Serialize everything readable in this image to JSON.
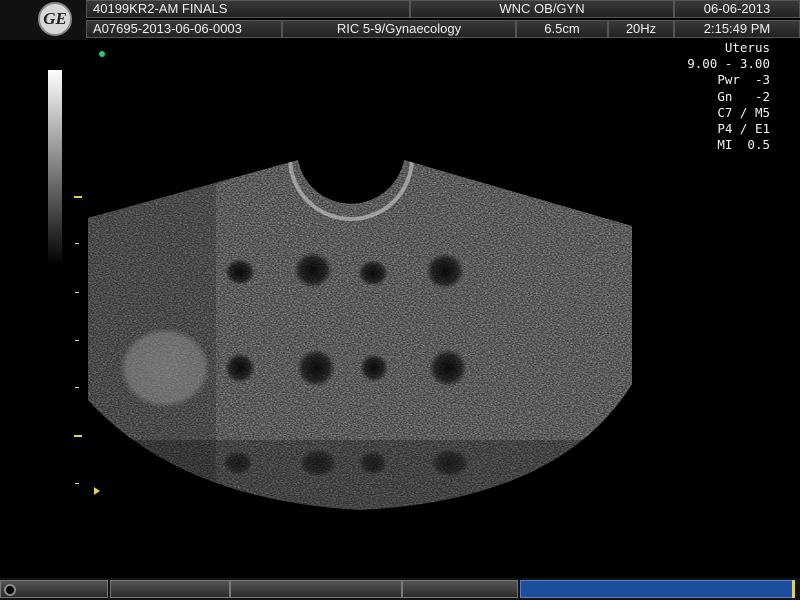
{
  "header": {
    "row1": {
      "exam_name": "40199KR2-AM FINALS",
      "institution": "WNC OB/GYN",
      "date": "06-06-2013"
    },
    "row2": {
      "patient_id": "A07695-2013-06-06-0003",
      "probe_preset": "RIC 5-9/Gynaecology",
      "depth": "6.5cm",
      "frame_rate": "20Hz",
      "time": "2:15:49 PM"
    }
  },
  "logo": {
    "text": "GE",
    "icon": "ge-logo"
  },
  "image_params": [
    "Uterus",
    "9.00 - 3.00",
    "Pwr  -3",
    "Gn   -2",
    "C7 / M5",
    "P4 / E1",
    "MI  0.5"
  ],
  "footer": {
    "progress_fraction": 0.99
  },
  "colors": {
    "marker_yellow": "#e6d050",
    "status_green": "#1fd06a",
    "progress_blue": "#1e4f9e"
  }
}
